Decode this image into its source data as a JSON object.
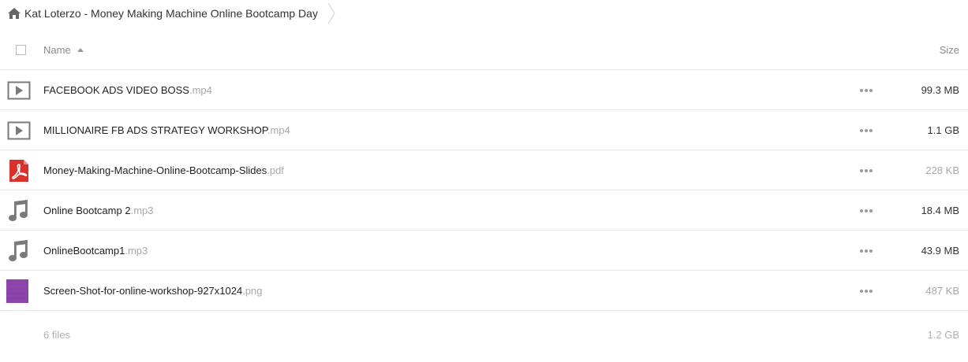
{
  "breadcrumb": {
    "icon": "home-icon",
    "title": "Kat Loterzo - Money Making Machine Online Bootcamp Day"
  },
  "header": {
    "name_label": "Name",
    "size_label": "Size"
  },
  "files": [
    {
      "base": "FACEBOOK ADS VIDEO BOSS",
      "ext": ".mp4",
      "size": "99.3 MB",
      "icon": "video-icon"
    },
    {
      "base": "MILLIONAIRE FB ADS STRATEGY WORKSHOP",
      "ext": ".mp4",
      "size": "1.1 GB",
      "icon": "video-icon"
    },
    {
      "base": "Money-Making-Machine-Online-Bootcamp-Slides",
      "ext": ".pdf",
      "size": "228 KB",
      "icon": "pdf-icon"
    },
    {
      "base": "Online Bootcamp 2",
      "ext": ".mp3",
      "size": "18.4 MB",
      "icon": "music-note-icon"
    },
    {
      "base": "OnlineBootcamp1",
      "ext": ".mp3",
      "size": "43.9 MB",
      "icon": "music-note-icon"
    },
    {
      "base": "Screen-Shot-for-online-workshop-927x1024",
      "ext": ".png",
      "size": "487 KB",
      "icon": "image-thumbnail"
    }
  ],
  "footer": {
    "count": "6 files",
    "total": "1.2 GB"
  },
  "colors": {
    "pdf_red": "#d9322d",
    "thumbnail_purple": "#8e44ad",
    "icon_gray": "#7a7a7a"
  }
}
